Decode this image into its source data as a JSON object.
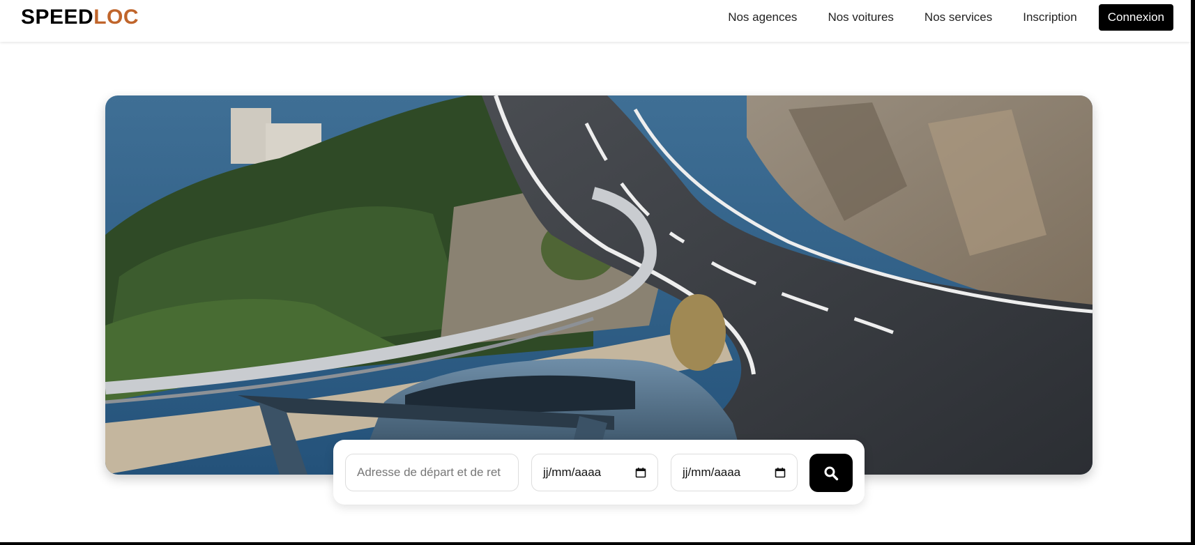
{
  "brand": {
    "part1": "SPEED",
    "part2": "LOC",
    "accent_color": "#c0652b"
  },
  "nav": {
    "items": [
      {
        "label": "Nos agences"
      },
      {
        "label": "Nos voitures"
      },
      {
        "label": "Nos services"
      },
      {
        "label": "Inscription"
      }
    ],
    "login_label": "Connexion"
  },
  "hero": {
    "image_alt": "Voiture de sport sur une route côtière sinueuse"
  },
  "search": {
    "address_placeholder": "Adresse de départ et de ret",
    "start_date_placeholder": "jj/mm/aaaa",
    "end_date_placeholder": "jj/mm/aaaa",
    "button_icon": "search-icon",
    "date_icon": "calendar-icon"
  }
}
